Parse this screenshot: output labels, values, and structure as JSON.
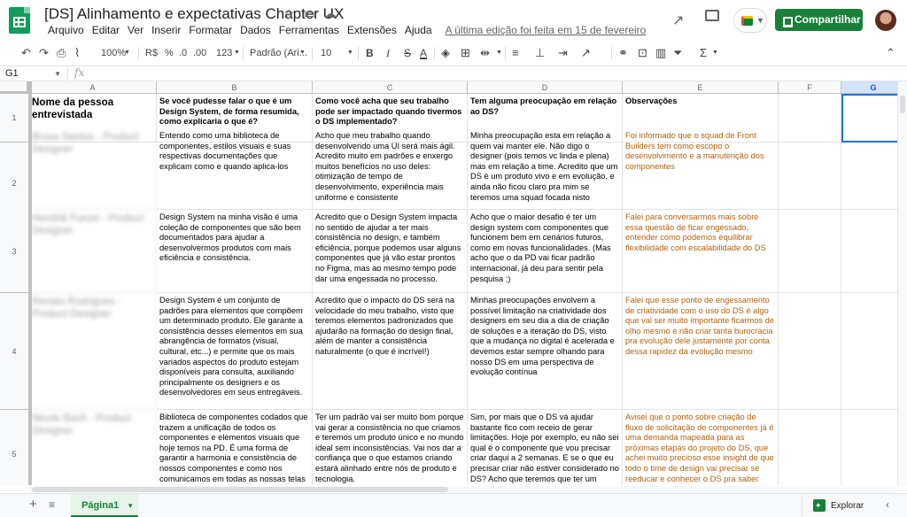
{
  "doc": {
    "title": "[DS] Alinhamento e expectativas Chapter UX",
    "last_edit": "A última edição foi feita em 15 de fevereiro",
    "share_label": "Compartilhar"
  },
  "menu": [
    "Arquivo",
    "Editar",
    "Ver",
    "Inserir",
    "Formatar",
    "Dados",
    "Ferramentas",
    "Extensões",
    "Ajuda"
  ],
  "toolbar": {
    "zoom": "100%",
    "currency": "R$",
    "percent": "%",
    "dec_less": ".0",
    "dec_more": ".00",
    "num_format": "123",
    "font": "Padrão (Ari...",
    "font_size": "10",
    "bold": "B",
    "italic": "I",
    "strike": "S",
    "text_color": "A"
  },
  "formula_bar": {
    "cell_ref": "G1",
    "fx": "fx"
  },
  "columns": [
    "A",
    "B",
    "C",
    "D",
    "E",
    "F",
    "G"
  ],
  "rows": [
    {
      "num": "1",
      "a": "Nome da pessoa entrevistada",
      "b": "Se você pudesse falar o que é um Design System, de forma resumida, como explicaria o que é?",
      "c": "Como você acha que seu trabalho pode ser impactado quando tivermos o DS implementado?",
      "d": "Tem alguma preocupação em relação ao DS?",
      "e": "Observações"
    },
    {
      "num": "2",
      "a": "Bruno Santos - Product Designer",
      "b": "Entendo como uma biblioteca de componentes, estilos visuais e suas respectivas documentações que explicam como e quando aplica-los",
      "c": "Acho que meu trabalho quando desenvolvendo uma UI será mais ágil. Acredito muito em padrões e enxergo muitos benefícios no uso deles: otimização de tempo de desenvolvimento, experiência mais uniforme e consistente",
      "d": "Minha preocupação esta em relação a quem vai manter ele. Não digo o designer (pois temos vc linda e plena) mas em relação a time. Acredito que um DS é um produto vivo e em evolução, e ainda não ficou claro pra mim se teremos uma squad focada nisto",
      "e": "Foi informado que o squad de Front Builders tem como escopo o desenvolvimento e a manutenção dos componentes"
    },
    {
      "num": "3",
      "a": "Hendrik Furuni - Product Designer",
      "b": "Design System na minha visão é uma coleção de componentes que são bem documentados para ajudar a desenvolvermos produtos com mais eficiência e consistência.",
      "c": "Acredito que o Design System impacta no sentido de ajudar a ter mais consistência no design, e também eficiência, porque podemos usar alguns componentes que já vão estar prontos no Figma, mas ao mesmo tempo pode dar uma engessada no processo.",
      "d": "Acho que o maior desafio é ter um design system com componentes que funcionem bem em cenários futuros, como em novas funcionalidades. (Mas acho que o da PD vai ficar padrão internacional, já deu para sentir pela pesquisa ;)",
      "e": "Falei para conversarmos mais sobre essa questão de ficar engessado, entender como podemos equilibrar flexibilidade com escalabilidade do DS"
    },
    {
      "num": "4",
      "a": "Renata Rodrigues - Product Designer",
      "b": "Design System é um conjunto de padrões para elementos que compõem um determinado produto. Ele garante a consistência desses elementos em sua abrangência de formatos (visual, cultural, etc...) e permite que os mais variados aspectos do produto estejam disponíveis para consulta, auxiliando principalmente os designers e os desenvolvedores em seus entregáveis.",
      "c": "Acredito que o impacto do DS será na velocidade do meu trabalho, visto que teremos elementos padronizados que ajudarão na formação do design final, além de manter a consistência naturalmente (o que é incrível!)",
      "d": "Minhas preocupações envolvem a possível limitação na criatividade dos designers em seu dia a dia de criação de soluções e a iteração do DS, visto que a mudança no digital é acelerada e devemos estar sempre olhando para nosso DS em uma perspectiva de evolução contínua",
      "e": "Falei que esse ponto de engessamento de criatividade com o uso do DS é algo que vai ser muito importante ficarmos de olho mesmo e não criar tanta burocracia pra evolução dele justamente por conta dessa rapidez da evolução mesmo"
    },
    {
      "num": "5",
      "a": "Nicole Bach - Product Designer",
      "b": "Biblioteca de componentes codados que trazem a unificação de todos os componentes e elementos visuais que hoje temos na PD. É uma forma de garantir a harmonia e consistência de nossos componentes e como nos comunicamos em todas as nossas telas independente de",
      "c": "Ter um padrão vai ser muito bom porque vai gerar a consistência no que criamos e teremos um produto único e no mundo ideal sem inconsistências. Vai nos dar a confiança que o que estamos criando estará alinhado entre nós de produto e tecnologia.",
      "d": "Sim, por mais que o DS vá ajudar bastante fico com receio de gerar limitações. Hoje por exemplo, eu não sei qual é o componente que vou precisar criar daqui a 2 semanas. E se o que eu precisar criar não estiver considerado no DS? Acho que teremos que ter um processo bem",
      "e": "Avisei que o ponto sobre criação de fluxo de solicitação de componentes já é uma demanda mapeada para as próximas etapas do projeto do DS, que achei muito precioso esse insight de que todo o time de design vai precisar se reeducar e conhecer o DS pra saber como aplicar."
    }
  ],
  "sheet_tab": "Página1",
  "explore_label": "Explorar"
}
